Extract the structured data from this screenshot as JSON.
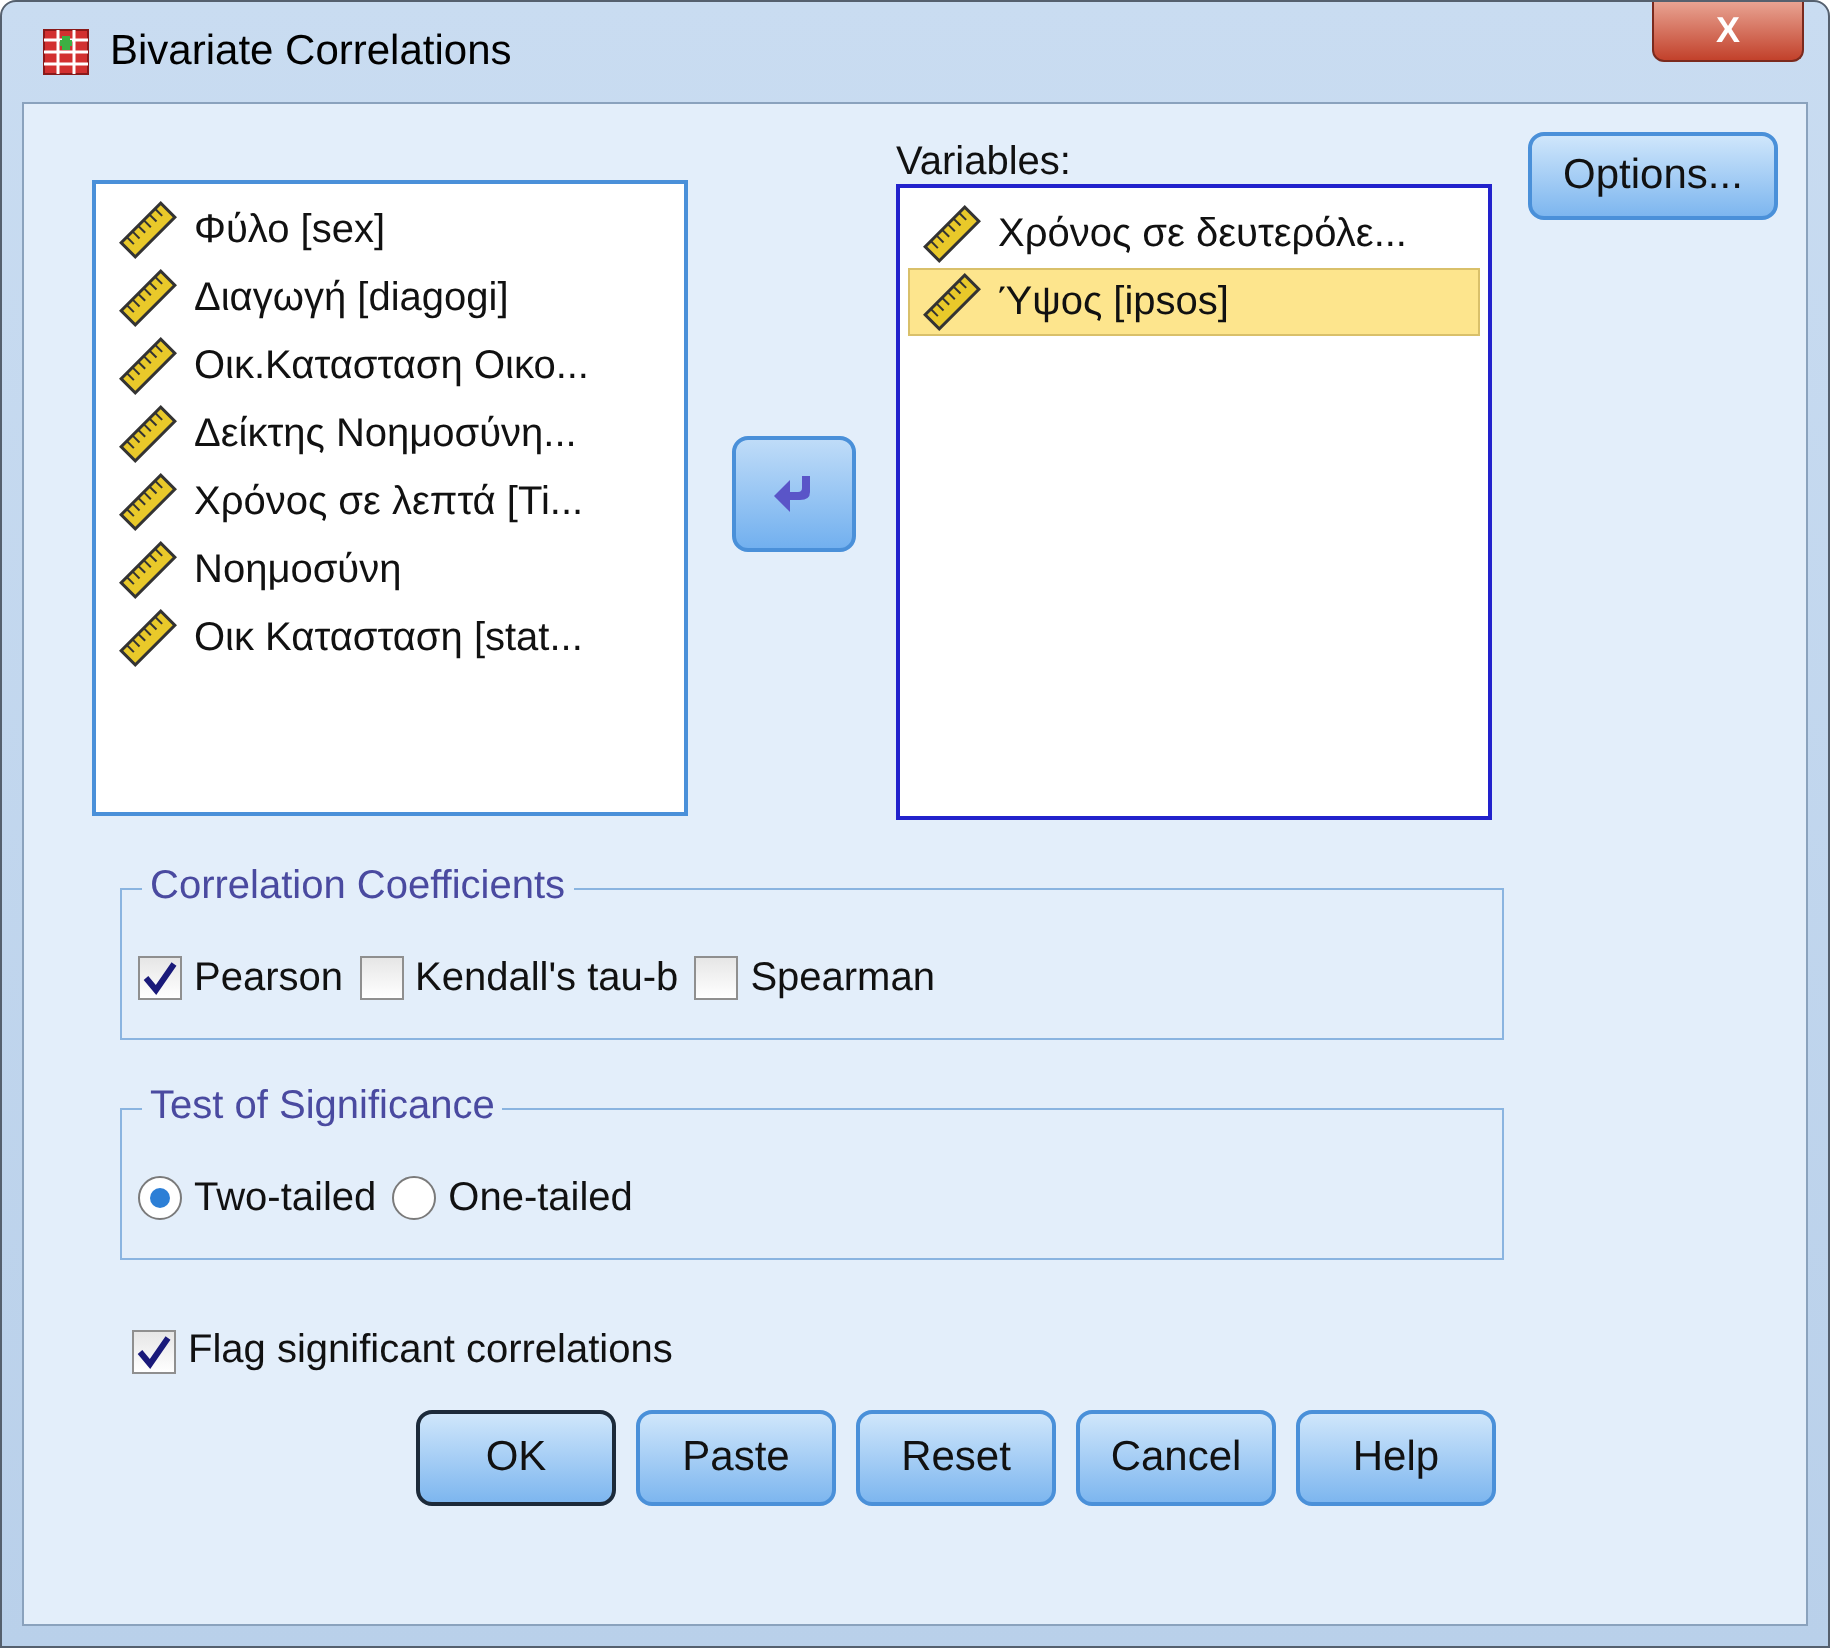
{
  "window": {
    "title": "Bivariate Correlations",
    "close": "X"
  },
  "source_list": {
    "items": [
      {
        "label": "Φύλο [sex]",
        "selected": false
      },
      {
        "label": "Διαγωγή [diagogi]",
        "selected": false
      },
      {
        "label": "Οικ.Κατασταση Οικο...",
        "selected": false
      },
      {
        "label": "Δείκτης Νοημοσύνη...",
        "selected": false
      },
      {
        "label": "Χρόνος σε λεπτά [Ti...",
        "selected": false
      },
      {
        "label": "Νοημοσύνη",
        "selected": false
      },
      {
        "label": "Οικ Κατασταση [stat...",
        "selected": false
      }
    ]
  },
  "variables": {
    "label": "Variables:",
    "items": [
      {
        "label": "Χρόνος σε δευτερόλε...",
        "selected": false
      },
      {
        "label": "Ύψος [ipsos]",
        "selected": true
      }
    ]
  },
  "options_button": "Options...",
  "correlation_coefficients": {
    "title": "Correlation Coefficients",
    "options": [
      {
        "label": "Pearson",
        "checked": true
      },
      {
        "label": "Kendall's tau-b",
        "checked": false
      },
      {
        "label": "Spearman",
        "checked": false
      }
    ]
  },
  "test_of_significance": {
    "title": "Test of Significance",
    "options": [
      {
        "label": "Two-tailed",
        "selected": true
      },
      {
        "label": "One-tailed",
        "selected": false
      }
    ]
  },
  "flag_significant": {
    "label": "Flag significant correlations",
    "checked": true
  },
  "buttons": [
    {
      "label": "OK",
      "default": true
    },
    {
      "label": "Paste",
      "default": false
    },
    {
      "label": "Reset",
      "default": false
    },
    {
      "label": "Cancel",
      "default": false
    },
    {
      "label": "Help",
      "default": false
    }
  ]
}
